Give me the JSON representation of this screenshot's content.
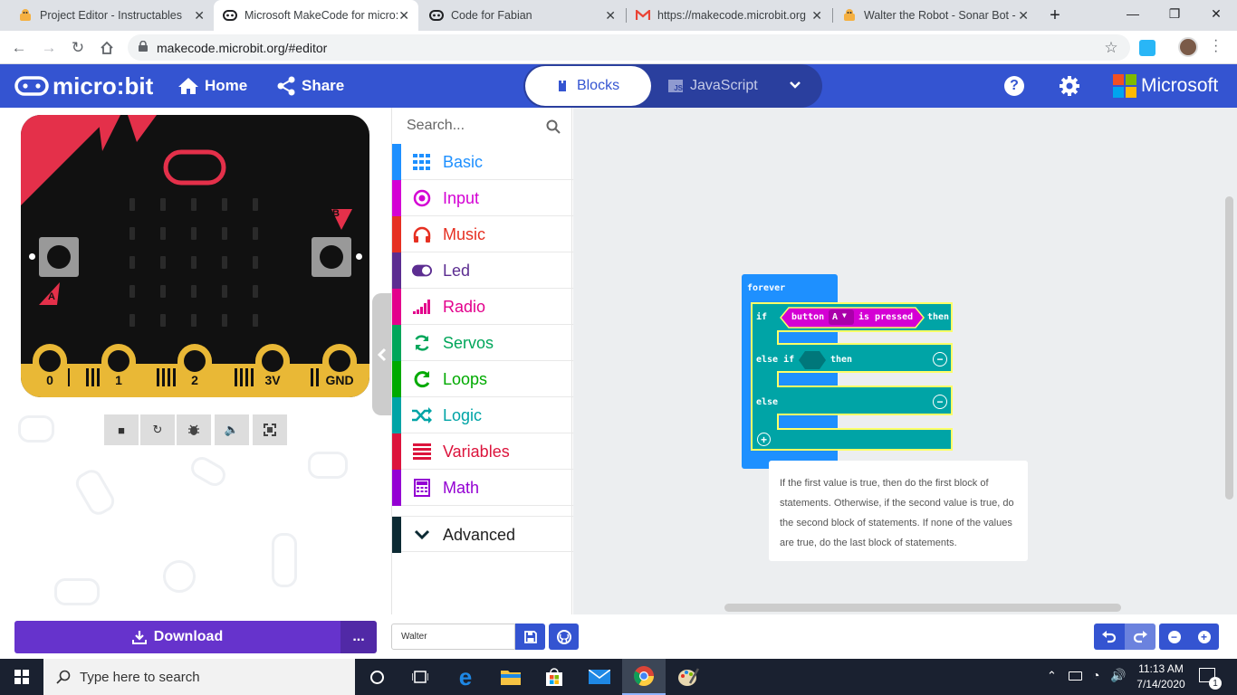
{
  "browser": {
    "tabs": [
      {
        "title": "Project Editor - Instructables",
        "icon": "instructables-robot-icon"
      },
      {
        "title": "Microsoft MakeCode for micro:bit",
        "icon": "microbit-icon"
      },
      {
        "title": "Code for Fabian",
        "icon": "microbit-icon"
      },
      {
        "title": "https://makecode.microbit.org",
        "icon": "gmail-icon"
      },
      {
        "title": "Walter the Robot - Sonar Bot -",
        "icon": "instructables-robot-icon"
      }
    ],
    "url": "makecode.microbit.org/#editor"
  },
  "header": {
    "brand": "micro:bit",
    "home_label": "Home",
    "share_label": "Share",
    "blocks_label": "Blocks",
    "js_label": "JavaScript",
    "microsoft_label": "Microsoft"
  },
  "simulator": {
    "button_a_label": "A",
    "button_b_label": "B",
    "pins": [
      "0",
      "1",
      "2",
      "3V",
      "GND"
    ]
  },
  "toolbox": {
    "search_placeholder": "Search...",
    "categories": [
      {
        "label": "Basic",
        "color": "#1e90ff"
      },
      {
        "label": "Input",
        "color": "#d400d4"
      },
      {
        "label": "Music",
        "color": "#e63022"
      },
      {
        "label": "Led",
        "color": "#5c2d91"
      },
      {
        "label": "Radio",
        "color": "#e3008c"
      },
      {
        "label": "Servos",
        "color": "#00a65a"
      },
      {
        "label": "Loops",
        "color": "#00aa00"
      },
      {
        "label": "Logic",
        "color": "#00a4a6"
      },
      {
        "label": "Variables",
        "color": "#dc143c"
      },
      {
        "label": "Math",
        "color": "#9400d3"
      }
    ],
    "advanced_label": "Advanced"
  },
  "workspace": {
    "forever_label": "forever",
    "if_label": "if",
    "button_label": "button",
    "button_value": "A",
    "is_pressed_label": "is pressed",
    "then_label": "then",
    "else_if_label": "else if",
    "else_label": "else",
    "tooltip": "If the first value is true, then do the first block of statements. Otherwise, if the second value is true, do the second block of statements. If none of the values are true, do the last block of statements."
  },
  "bottom": {
    "download_label": "Download",
    "more_label": "...",
    "project_name": "Walter"
  },
  "taskbar": {
    "search_placeholder": "Type here to search",
    "time": "11:13 AM",
    "date": "7/14/2020",
    "notification_count": "1"
  },
  "colors": {
    "header_blue": "#3454d1",
    "loops_green": "#00a65a",
    "logic_teal": "#00a4a6",
    "input_magenta": "#d400d4",
    "download_purple": "#6633cc"
  }
}
